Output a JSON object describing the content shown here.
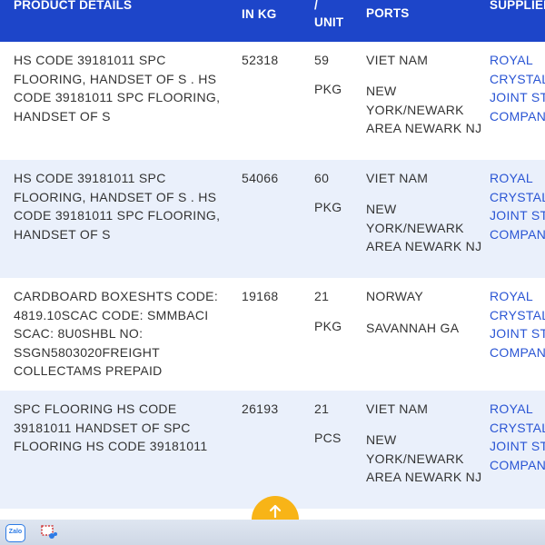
{
  "header": {
    "product_details": "PRODUCT DETAILS",
    "weight": "IN KG",
    "quantity_top": "/",
    "quantity_unit": "UNIT",
    "ports": "PORTS",
    "supplier": "SUPPLIER"
  },
  "rows": [
    {
      "product": "HS CODE 39181011 SPC FLOORING, HANDSET OF S . HS CODE 39181011 SPC FLOORING, HANDSET OF S",
      "weight": "52318",
      "qty": "59",
      "unit": "PKG",
      "origin": "VIET NAM",
      "destination": "NEW YORK/NEWARK AREA NEWARK NJ",
      "supplier": "ROYAL CRYSTAL JOINT STO COMPAN"
    },
    {
      "product": "HS CODE 39181011 SPC FLOORING, HANDSET OF S . HS CODE 39181011 SPC FLOORING, HANDSET OF S",
      "weight": "54066",
      "qty": "60",
      "unit": "PKG",
      "origin": "VIET NAM",
      "destination": "NEW YORK/NEWARK AREA NEWARK NJ",
      "supplier": "ROYAL CRYSTAL JOINT STO COMPAN"
    },
    {
      "product": "CARDBOARD BOXESHTS CODE: 4819.10SCAC CODE: SMMBACI SCAC: 8U0SHBL NO: SSGN5803020FREIGHT COLLECTAMS PREPAID",
      "weight": "19168",
      "qty": "21",
      "unit": "PKG",
      "origin": "NORWAY",
      "destination": "SAVANNAH GA",
      "supplier": "ROYAL CRYSTAL JOINT STO COMPAN"
    },
    {
      "product": "SPC FLOORING HS CODE 39181011 HANDSET OF SPC FLOORING HS CODE 39181011",
      "weight": "26193",
      "qty": "21",
      "unit": "PCS",
      "origin": "VIET NAM",
      "destination": "NEW YORK/NEWARK AREA NEWARK NJ",
      "supplier": "ROYAL CRYSTAL JOINT STO COMPAN"
    }
  ],
  "taskbar": {
    "zalo_label": "Zalo"
  },
  "colors": {
    "header_bg": "#1d45c9",
    "alt_row_bg": "#eaf0fb",
    "supplier_link": "#2a55d4",
    "scroll_top_button": "#f8b417"
  },
  "icons": {
    "scroll_top": "arrow-up-icon",
    "zalo": "zalo-icon",
    "snip": "snipping-tool-icon"
  }
}
